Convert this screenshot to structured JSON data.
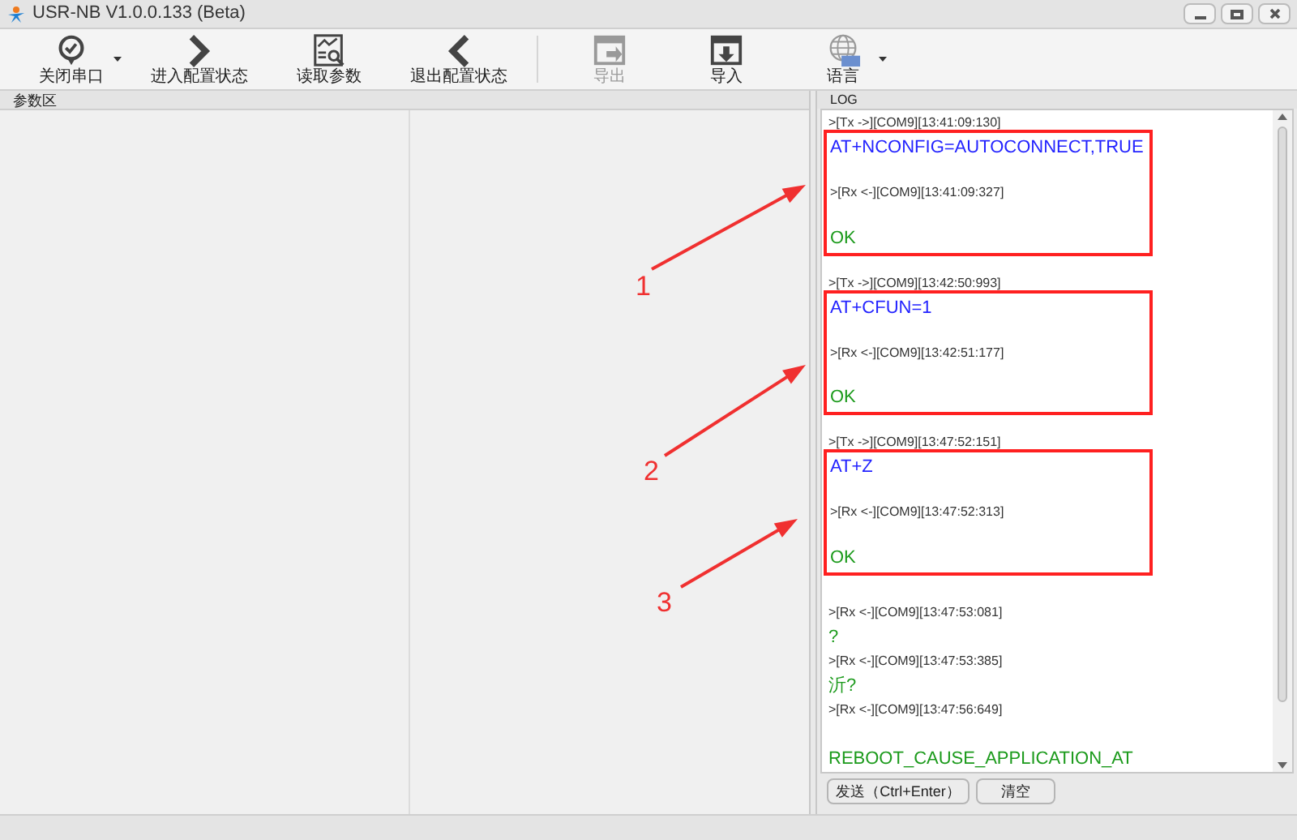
{
  "window": {
    "title": "USR-NB V1.0.0.133 (Beta)"
  },
  "toolbar": [
    {
      "label": "关闭串口",
      "dropdown": true,
      "disabled": false
    },
    {
      "label": "进入配置状态",
      "dropdown": false,
      "disabled": false
    },
    {
      "label": "读取参数",
      "dropdown": false,
      "disabled": false
    },
    {
      "label": "退出配置状态",
      "dropdown": false,
      "disabled": false
    },
    {
      "label": "导出",
      "dropdown": false,
      "disabled": true
    },
    {
      "label": "导入",
      "dropdown": false,
      "disabled": false
    },
    {
      "label": "语言",
      "dropdown": true,
      "disabled": false
    }
  ],
  "params_panel": {
    "title": "参数区"
  },
  "log_panel": {
    "title": "LOG",
    "blocks": [
      {
        "header": ">[Tx ->][COM9][13:41:09:130]",
        "boxed": true,
        "lines": [
          {
            "kind": "cmd",
            "text": "AT+NCONFIG=AUTOCONNECT,TRUE"
          },
          {
            "kind": "header",
            "text": ">[Rx <-][COM9][13:41:09:327]"
          },
          {
            "kind": "resp",
            "text": "OK"
          }
        ]
      },
      {
        "header": ">[Tx ->][COM9][13:42:50:993]",
        "boxed": true,
        "lines": [
          {
            "kind": "cmd",
            "text": "AT+CFUN=1"
          },
          {
            "kind": "header",
            "text": ">[Rx <-][COM9][13:42:51:177]"
          },
          {
            "kind": "resp",
            "text": "OK"
          }
        ]
      },
      {
        "header": ">[Tx ->][COM9][13:47:52:151]",
        "boxed": true,
        "lines": [
          {
            "kind": "cmd",
            "text": "AT+Z"
          },
          {
            "kind": "header",
            "text": ">[Rx <-][COM9][13:47:52:313]"
          },
          {
            "kind": "resp",
            "text": "OK"
          }
        ]
      },
      {
        "boxed": false,
        "lines": [
          {
            "kind": "header",
            "text": ">[Rx <-][COM9][13:47:53:081]"
          },
          {
            "kind": "resp",
            "text": "?"
          },
          {
            "kind": "header",
            "text": ">[Rx <-][COM9][13:47:53:385]"
          },
          {
            "kind": "resp",
            "text": "沂?"
          },
          {
            "kind": "header",
            "text": ">[Rx <-][COM9][13:47:56:649]"
          },
          {
            "kind": "gap"
          },
          {
            "kind": "resp",
            "text": "REBOOT_CAUSE_APPLICATION_AT"
          }
        ]
      }
    ],
    "buttons": [
      "发送（Ctrl+Enter）",
      "清空"
    ]
  },
  "annotations": [
    {
      "label": "1"
    },
    {
      "label": "2"
    },
    {
      "label": "3"
    }
  ]
}
